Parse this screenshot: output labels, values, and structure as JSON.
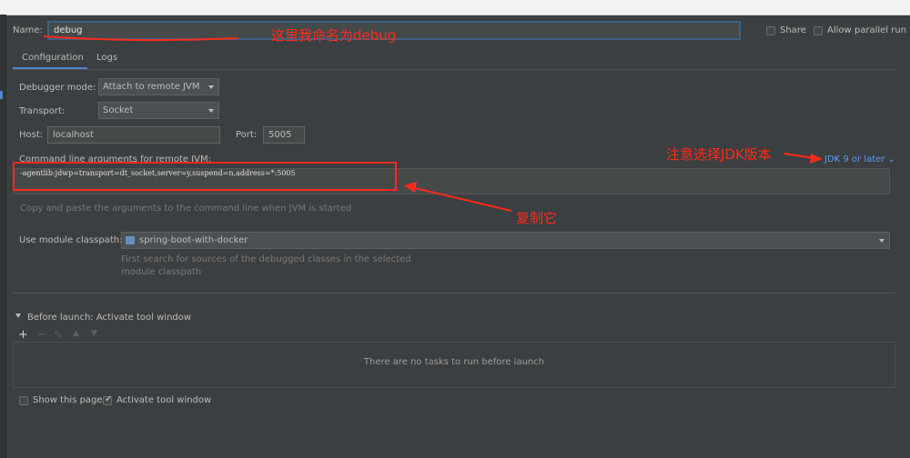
{
  "name_label": "Name:",
  "name_value": "debug",
  "share_label": "Share",
  "allow_parallel_label": "Allow parallel run",
  "tabs": [
    "Configuration",
    "Logs"
  ],
  "debugger_mode_label": "Debugger mode:",
  "debugger_mode_value": "Attach to remote JVM",
  "transport_label": "Transport:",
  "transport_value": "Socket",
  "host_label": "Host:",
  "host_value": "localhost",
  "port_label": "Port:",
  "port_value": "5005",
  "cmd_label": "Command line arguments for remote JVM:",
  "jdk_select": "JDK 9 or later",
  "cmd_value": "-agentlib:jdwp=transport=dt_socket,server=y,suspend=n,address=*:5005",
  "cmd_hint": "Copy and paste the arguments to the command line when JVM is started",
  "module_label": "Use module classpath:",
  "module_value": "spring-boot-with-docker",
  "module_hint_line1": "First search for sources of the debugged classes in the selected",
  "module_hint_line2": "module classpath",
  "before_launch_label": "Before launch: Activate tool window",
  "no_tasks": "There are no tasks to run before launch",
  "show_page_label": "Show this page",
  "activate_tool_label": "Activate tool window",
  "annotations": {
    "rename_note": "这里我命名为debug",
    "jdk_note": "注意选择JDK版本",
    "copy_note": "复制它"
  },
  "colors": {
    "background": "#3c3f41",
    "accent": "#4a88c7",
    "annotation": "#ff2a1a"
  }
}
